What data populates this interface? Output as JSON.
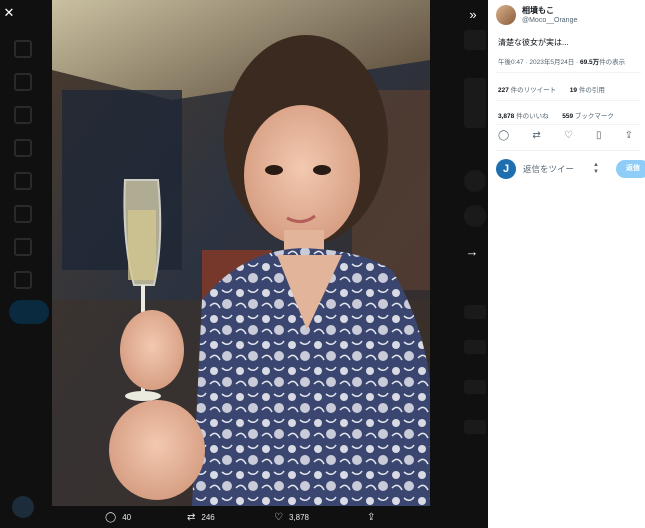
{
  "controls": {
    "close": "✕",
    "expand": "»",
    "next": "→"
  },
  "actions": {
    "reply_count": "40",
    "retweet_count": "246",
    "like_count": "3,878"
  },
  "tweet": {
    "author_name": "相墳もこ",
    "handle": "@Moco__Orange",
    "text": "清楚な彼女が実は...",
    "time": "午後0:47 · 2023年5月24日 ·",
    "views_count": "69.5万",
    "views_label": "件の表示",
    "retweets_count": "227",
    "retweets_label": "件のリツイート",
    "quotes_count": "19",
    "quotes_label": "件の引用",
    "likes_count": "3,878",
    "likes_label": "件のいいね",
    "bookmarks_count": "559",
    "bookmarks_label": "ブックマーク"
  },
  "reply": {
    "avatar_letter": "J",
    "placeholder": "返信をツイー",
    "button": "返信"
  },
  "colors": {
    "accent": "#1d9bf0",
    "reply_button": "#8ecdf8",
    "yukata": "#34406b"
  }
}
